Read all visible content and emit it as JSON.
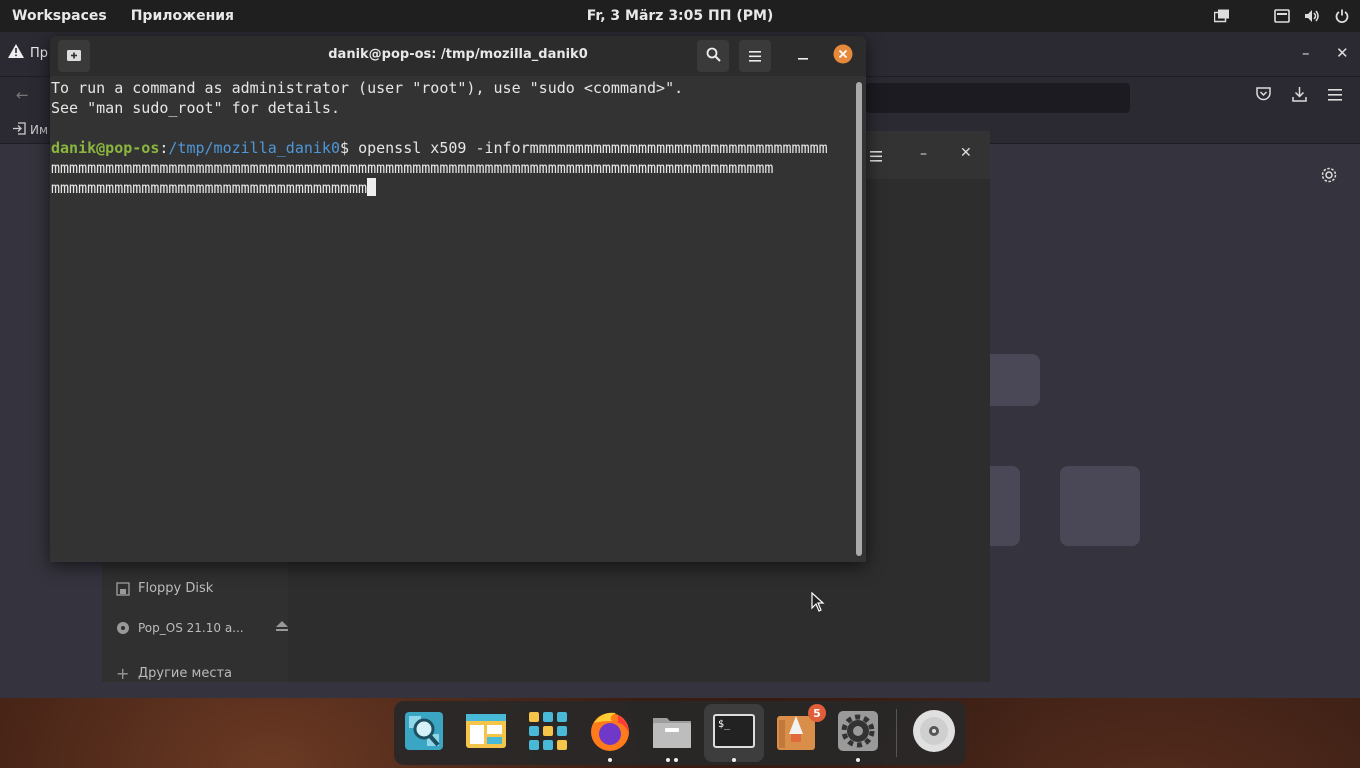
{
  "topbar": {
    "workspaces": "Workspaces",
    "apps": "Приложения",
    "clock": "Fr, 3 März   3:05 ПП (PM)",
    "tray_icons": [
      "window-switcher-icon",
      "keyboard-icon",
      "volume-icon",
      "power-icon"
    ]
  },
  "firefox": {
    "tab_label": "Пр",
    "bookmark_label": "Им"
  },
  "files": {
    "sidebar": {
      "floppy": "Floppy Disk",
      "popos": "Pop_OS 21.10 a...",
      "other": "Другие места"
    }
  },
  "terminal": {
    "title": "danik@pop-os: /tmp/mozilla_danik0",
    "lines": [
      "To run a command as administrator (user \"root\"), use \"sudo <command>\".",
      "See \"man sudo_root\" for details."
    ],
    "prompt_user": "danik@pop-os",
    "prompt_sep": ":",
    "prompt_path": "/tmp/mozilla_danik0",
    "prompt_dollar": "$ ",
    "command_start": "openssl x509 -informmmmmmmmmmmmmmmmmmmmmmmmmmmmmmmmm",
    "command_line2": "mmmmmmmmmmmmmmmmmmmmmmmmmmmmmmmmmmmmmmmmmmmmmmmmmmmmmmmmmmmmmmmmmmmmmmmmmmmmmmmm",
    "command_line3": "mmmmmmmmmmmmmmmmmmmmmmmmmmmmmmmmmmm"
  },
  "dock": {
    "items": [
      "search-app",
      "files-app",
      "app-grid",
      "firefox",
      "file-manager",
      "terminal",
      "pop-shop",
      "settings",
      "disc"
    ],
    "shop_badge": "5"
  },
  "colors": {
    "accent_close": "#e6893a",
    "prompt_user": "#8ab63f",
    "prompt_path": "#4f97d7"
  }
}
